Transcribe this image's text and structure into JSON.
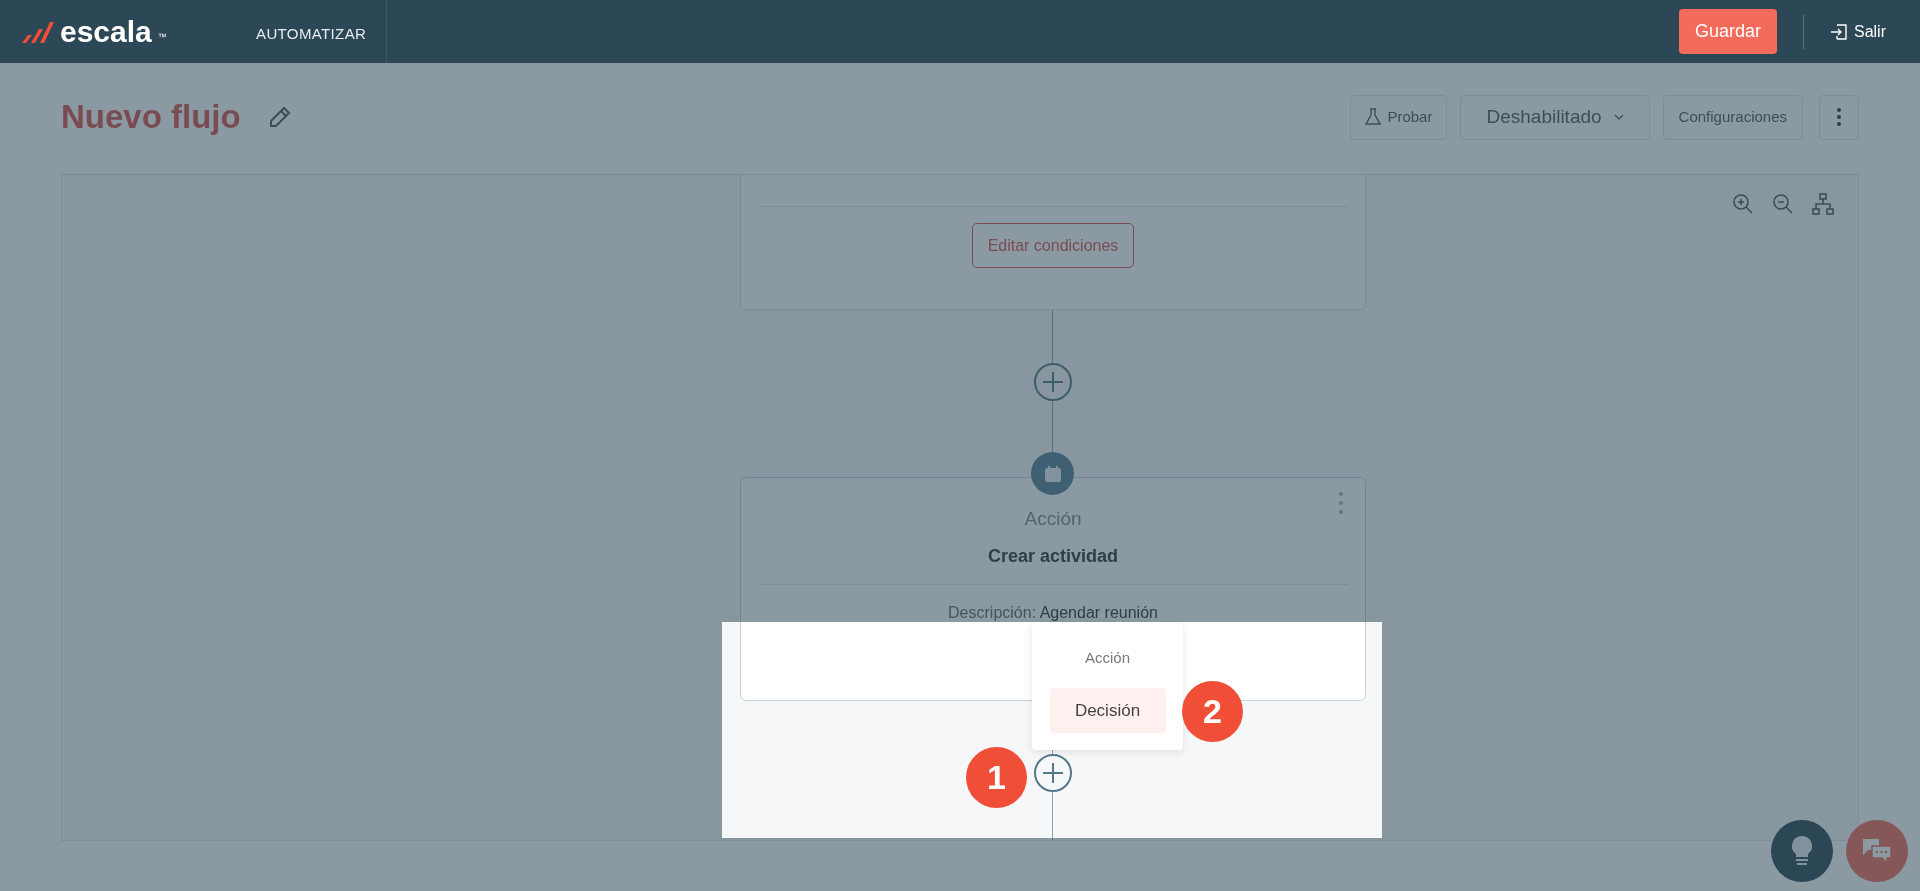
{
  "header": {
    "logo": "escala",
    "logo_trademark": "™",
    "nav_item": "AUTOMATIZAR",
    "save_button": "Guardar",
    "exit_button": "Salir"
  },
  "page": {
    "title": "Nuevo flujo",
    "test_button": "Probar",
    "status_dropdown": "Deshabilitado",
    "settings_button": "Configuraciones"
  },
  "canvas": {
    "condition_card": {
      "button": "Editar condiciones"
    },
    "action_card": {
      "type": "Acción",
      "title": "Crear actividad",
      "description_label": "Descripción:",
      "description_value": "Agendar reunión"
    }
  },
  "add_menu": {
    "items": [
      {
        "label": "Acción",
        "selected": false
      },
      {
        "label": "Decisión",
        "selected": true
      }
    ]
  },
  "step_badges": [
    "1",
    "2"
  ]
}
